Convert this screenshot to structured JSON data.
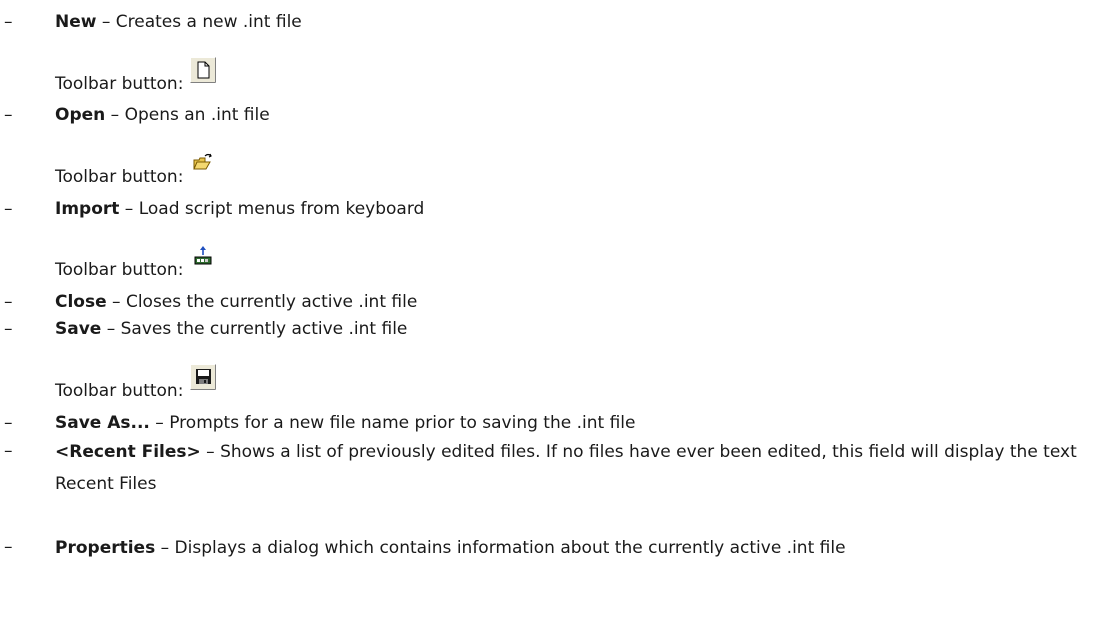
{
  "bullet": "–",
  "toolbar_label": "Toolbar button:",
  "items": [
    {
      "term": "New",
      "sep": " – ",
      "desc": "Creates a new .int file",
      "icon": "new-file-icon"
    },
    {
      "term": "Open",
      "sep": " – ",
      "desc": "Opens an .int file",
      "icon": "open-folder-icon"
    },
    {
      "term": "Import",
      "sep": " – ",
      "desc": "Load script menus from keyboard",
      "icon": "import-keyboard-icon"
    },
    {
      "term": "Close",
      "sep": " – ",
      "desc": "Closes the currently active .int file"
    },
    {
      "term": "Save",
      "sep": " – ",
      "desc": "Saves the currently active .int file",
      "icon": "save-disk-icon"
    },
    {
      "term": "Save As...",
      "sep": " – ",
      "desc": "Prompts for a new file name prior to saving the .int file"
    },
    {
      "term": "<Recent Files>",
      "sep": " – ",
      "desc": "Shows a list of previously edited files. If no files have ever been edited, this field will display the text Recent Files"
    },
    {
      "term": "Properties",
      "sep": " – ",
      "desc": "Displays a dialog which contains information about the currently active .int file"
    }
  ],
  "colors": {
    "text": "#1a1a1a",
    "icon_bg": "#ece9d8",
    "folder": "#e8c44a",
    "disk": "#1a1a1a"
  }
}
